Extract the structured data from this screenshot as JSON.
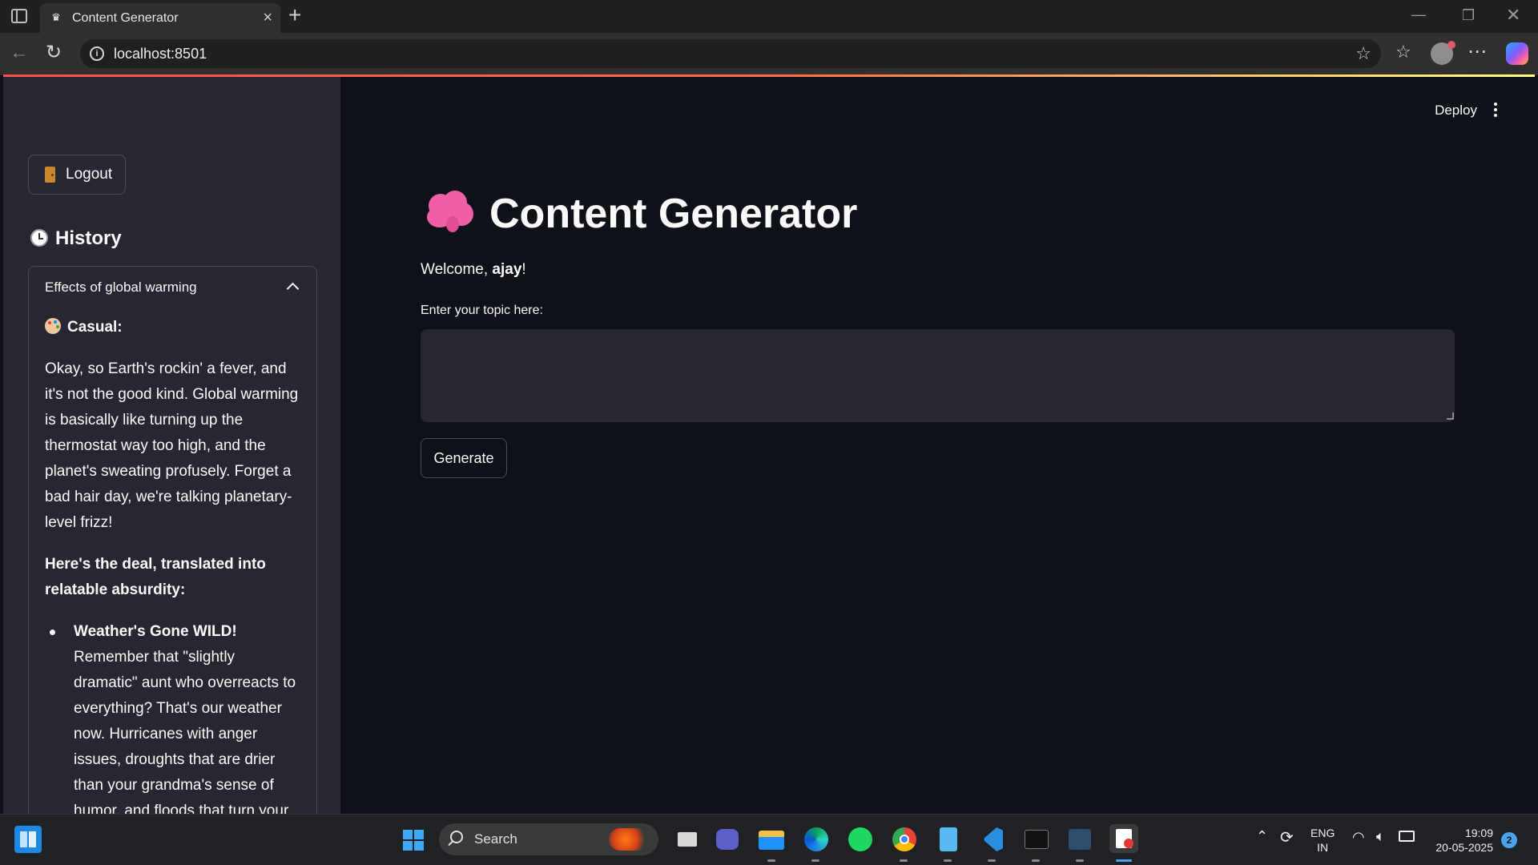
{
  "browser": {
    "tab_title": "Content Generator",
    "url": "localhost:8501"
  },
  "sidebar": {
    "logout_label": "Logout",
    "history_title": "History",
    "history_item": {
      "title": "Effects of global warming",
      "style_label": "Casual:",
      "paragraph_1": "Okay, so Earth's rockin' a fever, and it's not the good kind. Global warming is basically like turning up the thermostat way too high, and the planet's sweating profusely. Forget a bad hair day, we're talking planetary-level frizz!",
      "paragraph_2": "Here's the deal, translated into relatable absurdity:",
      "bullet_title": "Weather's Gone WILD!",
      "bullet_text": "Remember that \"slightly dramatic\" aunt who overreacts to everything? That's our weather now. Hurricanes with anger issues, droughts that are drier than your grandma's sense of humor, and floods that turn your"
    }
  },
  "header": {
    "deploy_label": "Deploy"
  },
  "main": {
    "title": "Content Generator",
    "welcome_prefix": "Welcome, ",
    "welcome_user": "ajay",
    "welcome_suffix": "!",
    "topic_label": "Enter your topic here:",
    "topic_value": "",
    "generate_label": "Generate"
  },
  "taskbar": {
    "search_text": "Search",
    "lang_top": "ENG",
    "lang_bottom": "IN",
    "time": "19:09",
    "date": "20-05-2025",
    "notification_count": "2"
  },
  "colors": {
    "app_bg": "#0e1117",
    "sidebar_bg": "#262730",
    "text": "#fafafa",
    "accent_line_start": "#ff4b4b",
    "accent_line_end": "#fffd80"
  }
}
